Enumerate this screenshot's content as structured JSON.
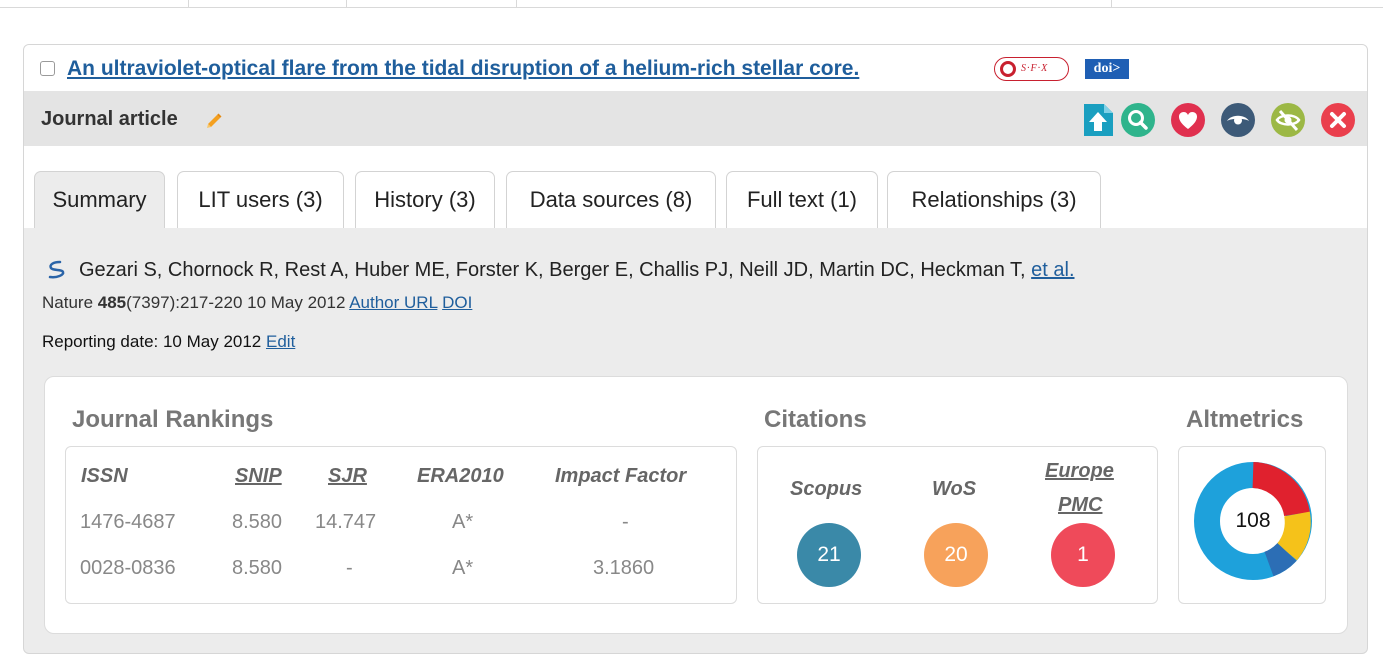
{
  "title": {
    "text": "An ultraviolet-optical flare from the tidal disruption of a helium-rich stellar core.",
    "sfx_label": "S·F·X",
    "doi_label": "doi>"
  },
  "type": {
    "label": "Journal article"
  },
  "actions": [
    {
      "name": "upload-icon",
      "color": "#1a9fc0"
    },
    {
      "name": "search-icon",
      "color": "#2fb48c"
    },
    {
      "name": "heart-icon",
      "color": "#e0304f"
    },
    {
      "name": "eye-icon",
      "color": "#3d5a78"
    },
    {
      "name": "hide-icon",
      "color": "#9cb845"
    },
    {
      "name": "close-icon",
      "color": "#ea3f4d"
    }
  ],
  "tabs": [
    {
      "label": "Summary"
    },
    {
      "label": "LIT users (3)"
    },
    {
      "label": "History (3)"
    },
    {
      "label": "Data sources (8)"
    },
    {
      "label": "Full text (1)"
    },
    {
      "label": "Relationships (3)"
    }
  ],
  "summary": {
    "authors": "Gezari S, Chornock R, Rest A, Huber ME, Forster K, Berger E, Challis PJ, Neill JD, Martin DC, Heckman T,",
    "et_al": "et al.",
    "journal": "Nature",
    "volume": "485",
    "issue_pages_date": "(7397):217-220 10 May 2012",
    "author_url_label": "Author URL",
    "doi_link_label": "DOI",
    "reporting_date": "Reporting date: 10 May 2012",
    "edit_label": "Edit"
  },
  "rankings": {
    "title": "Journal Rankings",
    "headers": [
      "ISSN",
      "SNIP",
      "SJR",
      "ERA2010",
      "Impact Factor"
    ],
    "rows": [
      [
        "1476-4687",
        "8.580",
        "14.747",
        "A*",
        "-"
      ],
      [
        "0028-0836",
        "8.580",
        "-",
        "A*",
        "3.1860"
      ]
    ]
  },
  "citations": {
    "title": "Citations",
    "scopus_label": "Scopus",
    "scopus_count": "21",
    "wos_label": "WoS",
    "wos_count": "20",
    "epmc_label_1": "Europe",
    "epmc_label_2": "PMC",
    "epmc_count": "1",
    "colors": {
      "scopus": "#3a89a8",
      "wos": "#f7a25b",
      "epmc": "#ef4a5a"
    }
  },
  "altmetrics": {
    "title": "Altmetrics",
    "score": "108"
  }
}
